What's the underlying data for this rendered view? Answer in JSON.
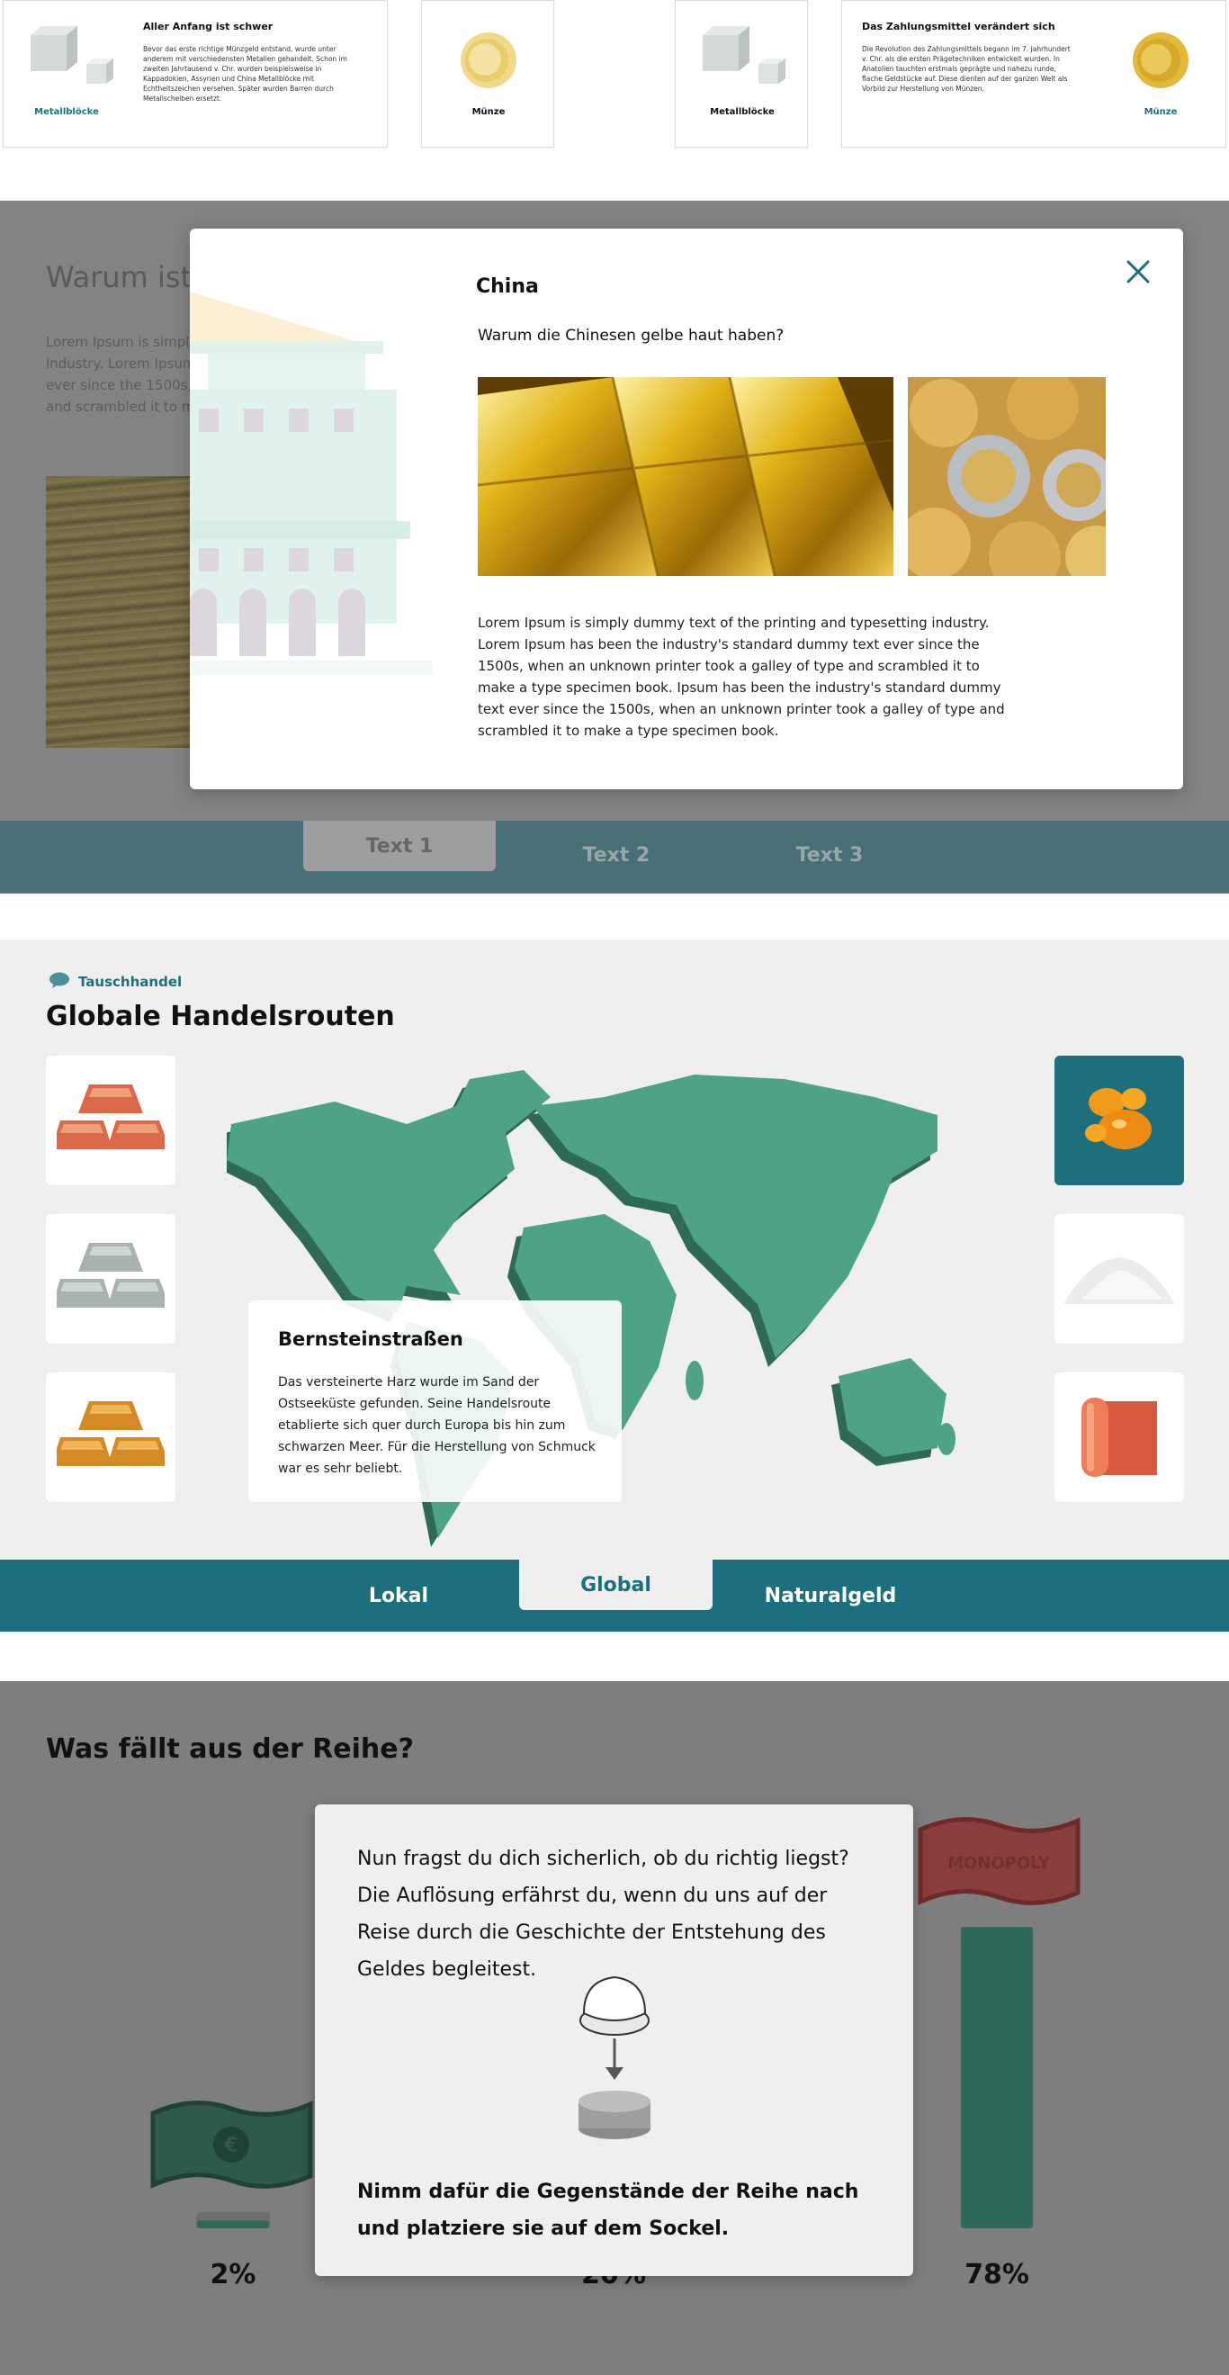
{
  "top_cards": {
    "card1": {
      "title": "Aller Anfang ist schwer",
      "text": "Bevor das erste richtige Münzgeld entstand, wurde unter anderem mit verschiedensten Metallen gehandelt. Schon im zweiten Jahrtausend v. Chr. wurden beispielsweise in Kappadokien, Assyrien und China Metallblöcke mit Echtheitszeichen versehen. Später wurden Barren durch Metallscheiben ersetzt.",
      "caption": "Metallblöcke"
    },
    "card2": {
      "caption": "Münze"
    },
    "card3": {
      "caption": "Metallblöcke"
    },
    "card4": {
      "title": "Das Zahlungsmittel verändert sich",
      "text": "Die Revolution des Zahlungsmittels begann im 7. Jahrhundert v. Chr. als die ersten Prägetechniken entwickelt wurden. In Anatolien tauchten erstmals geprägte und nahezu runde, flache Geldstücke auf. Diese dienten auf der ganzen Welt als Vorbild zur Herstellung von Münzen.",
      "caption": "Münze"
    }
  },
  "section1": {
    "bg_title": "Warum ist d",
    "bg_text": "Lorem Ipsum is simply industry. Lorem Ipsum ever since the 1500s, and scrambled it to ma",
    "tabs": [
      "Text 1",
      "Text 2",
      "Text 3"
    ],
    "active_tab": "Text 1",
    "modal": {
      "title": "China",
      "subtitle": "Warum die Chinesen gelbe haut haben?",
      "body": "Lorem Ipsum is simply dummy text of the printing and typesetting industry. Lorem Ipsum has been the industry's standard dummy text ever since the 1500s, when an unknown printer took a galley of type and scrambled it to make a type specimen book. Ipsum has been the industry's standard dummy text ever since the 1500s, when an unknown printer took a galley of type and scrambled it to make a type specimen book.",
      "close_icon": "close-icon"
    }
  },
  "section2": {
    "eyebrow": "Tauschhandel",
    "title": "Globale Handelsrouten",
    "info_title": "Bernsteinstraßen",
    "info_text": "Das versteinerte Harz wurde im Sand der Ostseeküste gefunden. Seine Handelsroute etablierte sich quer durch Europa bis hin zum schwarzen Meer. Für die Herstellung von Schmuck war es sehr beliebt.",
    "left_tiles": [
      "copper-bars-icon",
      "silver-bars-icon",
      "gold-bars-icon"
    ],
    "right_tiles": [
      "amber-icon",
      "salt-icon",
      "cloth-roll-icon"
    ],
    "tabs": [
      "Lokal",
      "Global",
      "Naturalgeld"
    ],
    "active_tab": "Global",
    "colors": {
      "map": "#4ea285",
      "map_shadow": "#2f6a55",
      "accent": "#1c6f7d"
    }
  },
  "section3": {
    "title": "Was fällt aus der Reihe?",
    "modal_text": "Nun fragst du dich sicherlich, ob du richtig liegst? Die Auflösung erfährst du, wenn du uns auf der Reise durch die Geschichte der Entstehung des Geldes begleitest.",
    "modal_cta": "Nimm dafür die Gegenstände der Reihe nach und platziere sie auf dem Sockel.",
    "chart_data": {
      "type": "bar",
      "categories": [
        "",
        "",
        ""
      ],
      "values": [
        2,
        20,
        78
      ],
      "value_labels": [
        "2%",
        "20%",
        "78%"
      ]
    }
  }
}
